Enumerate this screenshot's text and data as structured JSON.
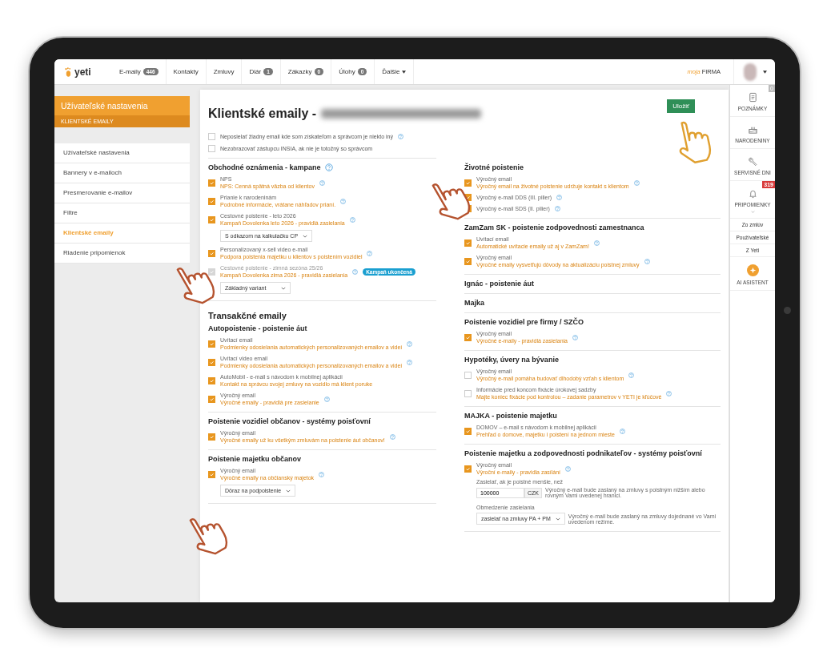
{
  "nav": {
    "logo": "yeti",
    "items": [
      {
        "label": "E-maily",
        "badge": "446"
      },
      {
        "label": "Kontakty"
      },
      {
        "label": "Zmluvy"
      },
      {
        "label": "Diár",
        "badge": "1"
      },
      {
        "label": "Zákazky",
        "badge": "0"
      },
      {
        "label": "Úlohy",
        "badge": "0"
      },
      {
        "label": "Ďalšie",
        "dropdown": true
      }
    ],
    "brand_prefix": "moja",
    "brand": "FIRMA"
  },
  "sidebar": {
    "title": "Užívateľské nastavenia",
    "subtitle": "KLIENTSKÉ EMAILY",
    "items": [
      {
        "label": "Užívateľské nastavenia",
        "selected": false
      },
      {
        "label": "Bannery v e-mailoch",
        "selected": false
      },
      {
        "label": "Presmerovanie e-mailov",
        "selected": false
      },
      {
        "label": "Filtre",
        "selected": false
      },
      {
        "label": "Klientské emaily",
        "selected": true
      },
      {
        "label": "Riadenie pripomienok",
        "selected": false
      }
    ]
  },
  "main": {
    "title": "Klientské emaily -",
    "save": "Uložiť",
    "options": [
      {
        "label": "Neposielať žiadny email kde som získateľom a správcom je niekto iný",
        "checked": false,
        "help": true
      },
      {
        "label": "Nezobrazovať zástupcu INSIA, ak nie je totožný so správcom",
        "checked": false,
        "help": false
      }
    ],
    "columns": [
      {
        "sections": [
          {
            "title": "Obchodné oznámenia - kampane",
            "help": true,
            "items": [
              {
                "kind": "check",
                "label": "NPS",
                "link": "NPS: Cenná spätná väzba od klientov",
                "checked": true,
                "disabled": false,
                "help": true
              },
              {
                "kind": "check",
                "label": "Prianie k narodeninám",
                "link": "Podrobné informácie, vrátane náhľadov prianí.",
                "checked": true,
                "disabled": false,
                "help": true
              },
              {
                "kind": "check",
                "label": "Cestovné poistenie - leto 2026",
                "link": "Kampaň Dovolenka leto 2026 - pravidlá zasielania",
                "checked": true,
                "disabled": false,
                "help": true
              },
              {
                "kind": "select",
                "value": "S odkazom na kalkulačku CP"
              },
              {
                "kind": "check",
                "label": "Personalizovaný x-sell video e-mail",
                "link": "Podpora poistenia majetku u klientov s poistením vozidiel",
                "checked": true,
                "disabled": false,
                "help": true
              },
              {
                "kind": "check",
                "label": "Cestovné poistenie - zimná sezóna 25/26",
                "link": "Kampaň Dovolenka zima 2026 - pravidlá zasielania",
                "checked": true,
                "disabled": true,
                "help": true,
                "badge": "Kampaň ukončená"
              },
              {
                "kind": "select",
                "value": "Základný variant"
              }
            ]
          },
          {
            "group_title": "Transakčné emaily",
            "title": "Autopoistenie - poistenie áut",
            "help": false,
            "items": [
              {
                "kind": "check",
                "label": "Uvítací email",
                "link": "Podmienky odosielania automatických personalizovaných emailov a videí",
                "checked": true,
                "disabled": false,
                "help": true
              },
              {
                "kind": "check",
                "label": "Uvítací video email",
                "link": "Podmienky odosielania automatických personalizovaných emailov a videí",
                "checked": true,
                "disabled": false,
                "help": true
              },
              {
                "kind": "check",
                "label": "AutoMobil - e-mail s návodom k mobilnej aplikácii",
                "link": "Kontakt na správcu svojej zmluvy na vozidlo má klient poruke",
                "checked": true,
                "disabled": false,
                "help": false
              },
              {
                "kind": "check",
                "label": "Výročný email",
                "link": "Výročné emaily - pravidlá pre zasielanie",
                "checked": true,
                "disabled": false,
                "help": true
              }
            ]
          },
          {
            "title": "Poistenie vozidiel občanov - systémy poisťovní",
            "help": false,
            "items": [
              {
                "kind": "check",
                "label": "Výročný email",
                "link": "Výročné emaily už ku všetkým zmluvám na poistenie áut občanov!",
                "checked": true,
                "disabled": false,
                "help": true
              }
            ]
          },
          {
            "title": "Poistenie majetku občanov",
            "help": false,
            "items": [
              {
                "kind": "check",
                "label": "Výročný email",
                "link": "Výročné emaily na občianský majetok",
                "checked": true,
                "disabled": false,
                "help": true
              },
              {
                "kind": "select",
                "value": "Dôraz na podpoistenie"
              }
            ]
          }
        ]
      },
      {
        "sections": [
          {
            "title": "Životné poistenie",
            "help": false,
            "items": [
              {
                "kind": "check",
                "label": "Výročný email",
                "link": "Výročný email na životné poistenie udržuje kontakt s klientom",
                "checked": true,
                "disabled": false,
                "help": true
              },
              {
                "kind": "check",
                "label": "Výročný e-mail DDS (III. pilier)",
                "checked": true,
                "disabled": false,
                "help": true
              },
              {
                "kind": "check",
                "label": "Výročný e-mail SDS (II. pilier)",
                "checked": true,
                "disabled": false,
                "help": true
              }
            ]
          },
          {
            "title": "ZamZam SK - poistenie zodpovednosti zamestnanca",
            "help": false,
            "items": [
              {
                "kind": "check",
                "label": "Uvítací email",
                "link": "Automatické uvítacie emaily už aj v ZamZam!",
                "checked": true,
                "disabled": false,
                "help": true
              },
              {
                "kind": "check",
                "label": "Výročný email",
                "link": "Výročné emaily vysvetľujú dôvody na aktualizáciu poistnej zmluvy",
                "checked": true,
                "disabled": false,
                "help": true
              }
            ]
          },
          {
            "title": "Ignác - poistenie áut",
            "help": false
          },
          {
            "title": "Majka",
            "help": false
          },
          {
            "title": "Poistenie vozidiel pre firmy / SZČO",
            "help": false,
            "items": [
              {
                "kind": "check",
                "label": "Výročný email",
                "link": "Výročné e-maily - pravidlá zasielania",
                "checked": true,
                "disabled": false,
                "help": true
              }
            ]
          },
          {
            "title": "Hypotéky, úvery na bývanie",
            "help": false,
            "items": [
              {
                "kind": "check",
                "label": "Výročný email",
                "link": "Výročný e-mail pomáha budovať dlhodobý vzťah s klientom",
                "checked": false,
                "disabled": false,
                "help": true
              },
              {
                "kind": "check",
                "label": "Informácie pred koncom fixácie úrokovej sadzby",
                "link": "Majte koniec fixácie pod kontrolou – zadanie parametrov v YETI je kľúčové",
                "checked": false,
                "disabled": false,
                "help": true
              }
            ]
          },
          {
            "title": "MAJKA - poistenie majetku",
            "help": false,
            "items": [
              {
                "kind": "check",
                "label": "DOMOV – e-mail s návodom k mobilnej aplikácii",
                "link": "Prehľad o domove, majetku i poistení na jednom mieste",
                "checked": true,
                "disabled": false,
                "help": true
              }
            ]
          },
          {
            "title": "Poistenie majetku a zodpovednosti podnikateľov - systémy poisťovní",
            "help": false,
            "items": [
              {
                "kind": "check",
                "label": "Výročný email",
                "link": "Výroční e-maily - pravidla zasílání",
                "checked": true,
                "disabled": false,
                "help": true
              },
              {
                "kind": "threshold",
                "label": "Zasielať, ak je poistné menšie, než",
                "value": "100000",
                "unit": "CZK",
                "note": "Výročný e-mail bude zaslaný na zmluvy s poistným nižším alebo rovným Vami uvedenej hranici."
              },
              {
                "kind": "select",
                "label": "Obmedzenie zasielania",
                "value": "zasielať na zmluvy PA + PM",
                "note": "Výročný e-mail bude zaslaný na zmluvy dojednané vo Vami uvedenom režime."
              }
            ]
          }
        ]
      }
    ]
  },
  "rail": {
    "items": [
      {
        "kind": "note",
        "label": "POZNÁMKY",
        "badge": "0",
        "alert": false
      },
      {
        "kind": "cake",
        "label": "NARODENINY"
      },
      {
        "kind": "wrench",
        "label": "SERVISNÉ DNI"
      },
      {
        "kind": "bell",
        "label": "PRIPOMIENKY",
        "badge": "319",
        "alert": true,
        "children": [
          {
            "label": "Zo zmlúv"
          },
          {
            "label": "Používateľské"
          },
          {
            "label": "Z Yeti"
          }
        ]
      },
      {
        "kind": "spark",
        "label": "AI ASISTENT"
      }
    ]
  }
}
